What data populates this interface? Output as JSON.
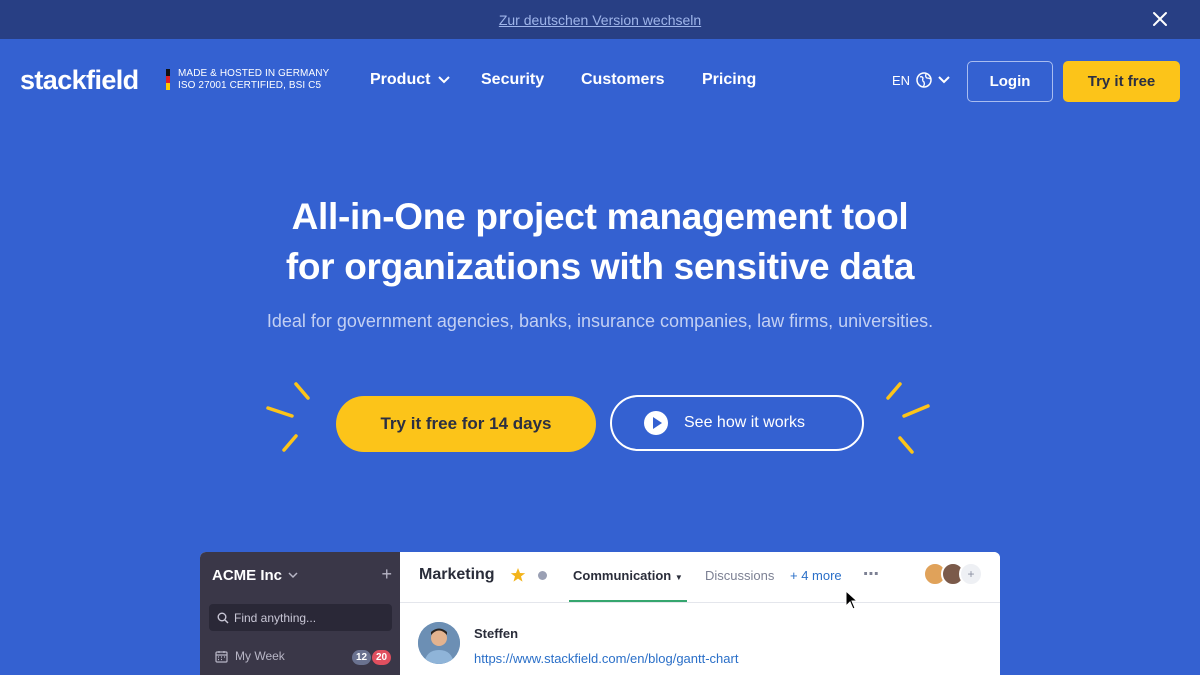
{
  "banner": {
    "link_text": "Zur deutschen Version wechseln"
  },
  "header": {
    "logo": "stackfield",
    "badge_line1": "MADE & HOSTED IN GERMANY",
    "badge_line2": "ISO 27001 CERTIFIED, BSI C5",
    "nav": {
      "product": "Product",
      "security": "Security",
      "customers": "Customers",
      "pricing": "Pricing"
    },
    "lang": "EN",
    "login": "Login",
    "try_free": "Try it free"
  },
  "hero": {
    "title_line1": "All-in-One project management tool",
    "title_line2": "for organizations with sensitive data",
    "subtitle": "Ideal for government agencies, banks, insurance companies, law firms, universities.",
    "cta_primary": "Try it free for 14 days",
    "cta_secondary": "See how it works"
  },
  "app_preview": {
    "workspace": "ACME Inc",
    "search_placeholder": "Find anything...",
    "my_week": "My Week",
    "count_a": "12",
    "count_b": "20",
    "room": "Marketing",
    "tab_active": "Communication",
    "tab_2": "Discussions",
    "tab_more": "+ 4 more",
    "post_author": "Steffen",
    "post_link": "https://www.stackfield.com/en/blog/gantt-chart"
  },
  "colors": {
    "background": "#3461d1",
    "banner": "#283f84",
    "accent_yellow": "#fcc419"
  }
}
